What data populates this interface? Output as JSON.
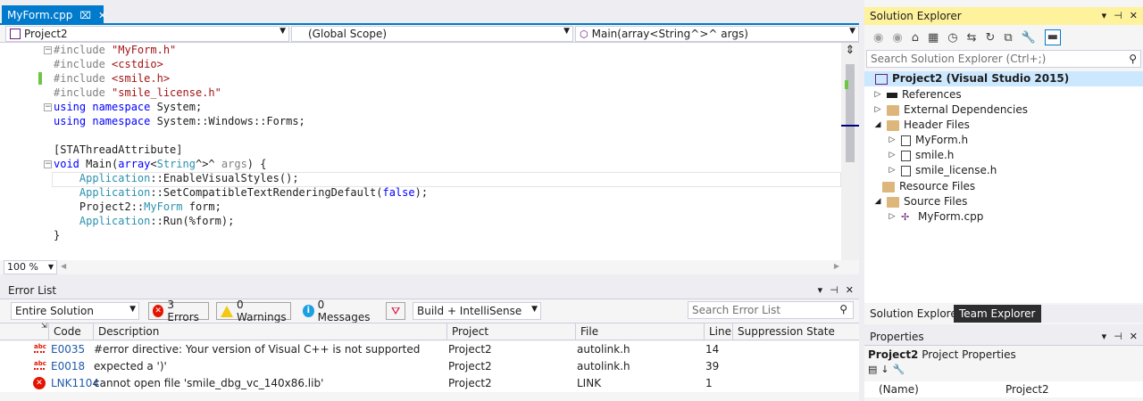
{
  "editor": {
    "tab_title": "MyForm.cpp",
    "pin_glyph": "⌧",
    "close_glyph": "✕",
    "nav": {
      "project": "Project2",
      "scope": "(Global Scope)",
      "member": "Main(array<String^>^ args)"
    },
    "zoom": "100 %"
  },
  "code_lines": [
    [
      [
        "pp",
        "#include "
      ],
      [
        "str",
        "\"MyForm.h\""
      ]
    ],
    [
      [
        "pp",
        "#include "
      ],
      [
        "str",
        "<cstdio>"
      ]
    ],
    [
      [
        "pp",
        "#include "
      ],
      [
        "str",
        "<smile.h>"
      ]
    ],
    [
      [
        "pp",
        "#include "
      ],
      [
        "str",
        "\"smile_license.h\""
      ]
    ],
    [
      [
        "kw",
        "using"
      ],
      [
        "t",
        " "
      ],
      [
        "kw",
        "namespace"
      ],
      [
        "t",
        " System;"
      ]
    ],
    [
      [
        "kw",
        "using"
      ],
      [
        "t",
        " "
      ],
      [
        "kw",
        "namespace"
      ],
      [
        "t",
        " System::Windows::Forms;"
      ]
    ],
    [
      [
        "t",
        ""
      ]
    ],
    [
      [
        "t",
        "[STAThreadAttribute]"
      ]
    ],
    [
      [
        "kw",
        "void"
      ],
      [
        "t",
        " Main("
      ],
      [
        "kw",
        "array"
      ],
      [
        "t",
        "<"
      ],
      [
        "ty",
        "String"
      ],
      [
        "t",
        "^>^ "
      ],
      [
        "pp",
        "args"
      ],
      [
        "t",
        ") {"
      ]
    ],
    [
      [
        "t",
        "    "
      ],
      [
        "ty",
        "Application"
      ],
      [
        "t",
        "::EnableVisualStyles();"
      ]
    ],
    [
      [
        "t",
        "    "
      ],
      [
        "ty",
        "Application"
      ],
      [
        "t",
        "::SetCompatibleTextRenderingDefault("
      ],
      [
        "kw",
        "false"
      ],
      [
        "t",
        ");"
      ]
    ],
    [
      [
        "t",
        "    Project2::"
      ],
      [
        "ty",
        "MyForm"
      ],
      [
        "t",
        " form;"
      ]
    ],
    [
      [
        "t",
        "    "
      ],
      [
        "ty",
        "Application"
      ],
      [
        "t",
        "::Run(%form);"
      ]
    ],
    [
      [
        "t",
        "}"
      ]
    ]
  ],
  "error_list": {
    "title": "Error List",
    "scope": "Entire Solution",
    "errors_label": "3 Errors",
    "warnings_label": "0 Warnings",
    "messages_label": "0 Messages",
    "source": "Build + IntelliSense",
    "search_placeholder": "Search Error List",
    "columns": {
      "code": "Code",
      "description": "Description",
      "project": "Project",
      "file": "File",
      "line": "Line",
      "suppression": "Suppression State"
    },
    "rows": [
      {
        "code": "E0035",
        "description": "#error directive: Your version of Visual C++ is not supported",
        "project": "Project2",
        "file": "autolink.h",
        "line": "14"
      },
      {
        "code": "E0018",
        "description": "expected a ')'",
        "project": "Project2",
        "file": "autolink.h",
        "line": "39"
      },
      {
        "code": "LNK1104",
        "description": "cannot open file 'smile_dbg_vc_140x86.lib'",
        "project": "Project2",
        "file": "LINK",
        "line": "1"
      }
    ]
  },
  "solution_explorer": {
    "title": "Solution Explorer",
    "search_placeholder": "Search Solution Explorer (Ctrl+;)",
    "project": "Project2 (Visual Studio 2015)",
    "items": {
      "references": "References",
      "external": "External Dependencies",
      "header_files": "Header Files",
      "myform_h": "MyForm.h",
      "smile_h": "smile.h",
      "smile_license_h": "smile_license.h",
      "resource_files": "Resource Files",
      "source_files": "Source Files",
      "myform_cpp": "MyForm.cpp"
    },
    "tab_solution": "Solution Explorer",
    "tab_team": "Team Explorer"
  },
  "properties": {
    "title": "Properties",
    "object_name": "Project2",
    "object_type": "Project Properties",
    "row_name": "(Name)",
    "row_value": "Project2"
  },
  "colors": {
    "accent": "#007ACC",
    "active_title": "#FFF29D",
    "error": "#E51400"
  }
}
